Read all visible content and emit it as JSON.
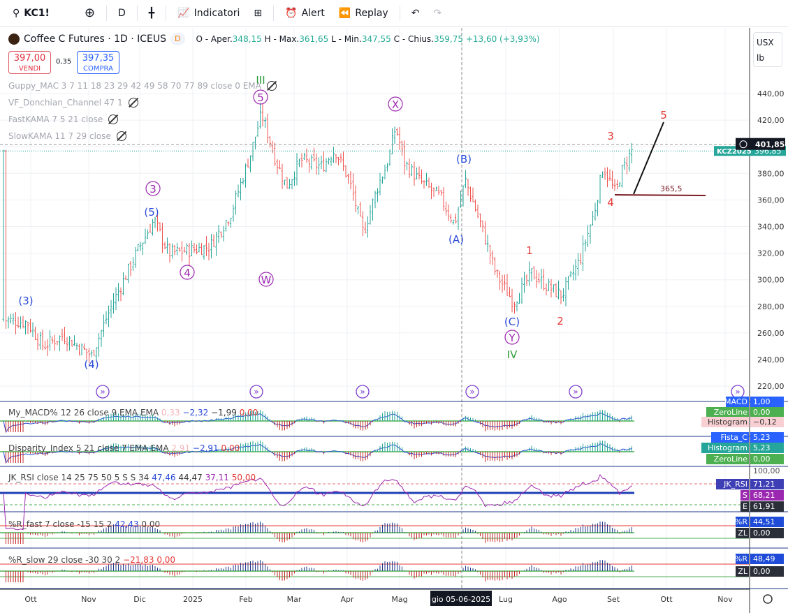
{
  "toolbar": {
    "symbol": "KC1!",
    "interval": "D",
    "indicators": "Indicatori",
    "alert": "Alert",
    "replay": "Replay"
  },
  "legend": {
    "title": "Coffee C Futures · 1D · ICEUS",
    "badge": "D",
    "o_label": "O - Aper.",
    "o": "348,15",
    "h_label": "H - Max.",
    "h": "361,65",
    "l_label": "L - Min.",
    "l": "347,55",
    "c_label": "C - Chius.",
    "c": "359,75",
    "change": "+13,60 (+3,93%)"
  },
  "trade": {
    "sell_price": "397,00",
    "sell_label": "VENDI",
    "spread": "0,35",
    "buy_price": "397,35",
    "buy_label": "COMPRA"
  },
  "indicators": [
    "Guppy_MAC 3 7 11 18 23 29 42 49 58 70 77 89 close 0 EMA",
    "VF_Donchian_Channel 47 1",
    "FastKAMA 7 5 21 close",
    "SlowKAMA 11 7 29 close"
  ],
  "price_axis": {
    "currency": "USX",
    "unit": "lb",
    "ticks": [
      "440,00",
      "420,00",
      "400,00",
      "380,00",
      "360,00",
      "340,00",
      "320,00",
      "300,00",
      "280,00",
      "260,00",
      "240,00",
      "220,00"
    ],
    "crosshair_price": "401,85",
    "symbol_label": "KCZ2025",
    "symbol_price": "396,85"
  },
  "time_axis": {
    "ticks": [
      "Ott",
      "Nov",
      "Dic",
      "2025",
      "Feb",
      "Mar",
      "Apr",
      "Mag",
      "Lug",
      "Ago",
      "Set",
      "Ott",
      "Nov"
    ],
    "crosshair_date": "gio 05-06-2025"
  },
  "waves": [
    {
      "t": "(3)",
      "c": "#2a4bd7"
    },
    {
      "t": "(4)",
      "c": "#2a4bd7"
    },
    {
      "t": "3",
      "c": "#9c27b0"
    },
    {
      "t": "(5)",
      "c": "#2a4bd7"
    },
    {
      "t": "4",
      "c": "#9c27b0"
    },
    {
      "t": "W",
      "c": "#9c27b0"
    },
    {
      "t": "III",
      "c": "#2e9b3a"
    },
    {
      "t": "5",
      "c": "#9c27b0"
    },
    {
      "t": "X",
      "c": "#9c27b0"
    },
    {
      "t": "(B)",
      "c": "#2a4bd7"
    },
    {
      "t": "(A)",
      "c": "#2a4bd7"
    },
    {
      "t": "(C)",
      "c": "#2a4bd7"
    },
    {
      "t": "Y",
      "c": "#9c27b0"
    },
    {
      "t": "IV",
      "c": "#2e9b3a"
    },
    {
      "t": "1",
      "c": "#e53935"
    },
    {
      "t": "2",
      "c": "#e53935"
    },
    {
      "t": "3",
      "c": "#e53935"
    },
    {
      "t": "4",
      "c": "#e53935"
    },
    {
      "t": "5",
      "c": "#e53935"
    }
  ],
  "level_label": "365,5",
  "panes": {
    "macd": {
      "legend": "My_MACD% 12 26 close 9 EMA EMA",
      "v1": "0,33",
      "v2": "−2,32",
      "v3": "−1,99",
      "v4": "0,00",
      "labels": [
        {
          "n": "MACD",
          "v": "1,00"
        },
        {
          "n": "ZeroLine",
          "v": "0,00"
        },
        {
          "n": "Histogram",
          "v": "−0,12"
        }
      ]
    },
    "disparity": {
      "legend": "Disparity_Index 5 21 close 7 EMA EMA",
      "v1": "2,91",
      "v2": "−2,91",
      "v3": "0,00",
      "labels": [
        {
          "n": "Fista_C",
          "v": "5,23"
        },
        {
          "n": "Histogram",
          "v": "5,23"
        },
        {
          "n": "ZeroLine",
          "v": "0,00"
        }
      ]
    },
    "rsi": {
      "legend": "JK_RSI close 14 25 75 50 5 S S 34",
      "v1": "47,46",
      "v2": "44,47",
      "v3": "37,11",
      "v4": "50,00",
      "top": "100,00",
      "labels": [
        {
          "n": "JK_RSI",
          "v": "71,21"
        },
        {
          "n": "S",
          "v": "68,21"
        },
        {
          "n": "E",
          "v": "61,91"
        }
      ]
    },
    "rfast": {
      "legend": "%R_fast 7 close -15 15 2",
      "v1": "42,43",
      "v2": "0,00",
      "labels": [
        {
          "n": "%R",
          "v": "44,51"
        },
        {
          "n": "ZL",
          "v": "0,00"
        }
      ]
    },
    "rslow": {
      "legend": "%R_slow 29 close -30 30 2",
      "v1": "−21,83",
      "v2": "0,00",
      "labels": [
        {
          "n": "%R",
          "v": "48,49"
        },
        {
          "n": "ZL",
          "v": "0,00"
        }
      ]
    }
  },
  "chart_data": {
    "type": "ohlc",
    "ylim": [
      210,
      450
    ],
    "x_unit": "days since 2024-10-01",
    "close_path": [
      [
        -15,
        270
      ],
      [
        -2,
        268
      ],
      [
        7,
        250
      ],
      [
        18,
        258
      ],
      [
        34,
        243
      ],
      [
        45,
        280
      ],
      [
        59,
        320
      ],
      [
        69,
        345
      ],
      [
        77,
        320
      ],
      [
        88,
        322
      ],
      [
        100,
        325
      ],
      [
        112,
        350
      ],
      [
        123,
        395
      ],
      [
        129,
        425
      ],
      [
        137,
        390
      ],
      [
        143,
        370
      ],
      [
        151,
        390
      ],
      [
        163,
        385
      ],
      [
        170,
        398
      ],
      [
        178,
        375
      ],
      [
        184,
        345
      ],
      [
        186,
        335
      ],
      [
        194,
        370
      ],
      [
        200,
        390
      ],
      [
        204,
        415
      ],
      [
        209,
        388
      ],
      [
        217,
        375
      ],
      [
        229,
        362
      ],
      [
        237,
        342
      ],
      [
        243,
        375
      ],
      [
        252,
        340
      ],
      [
        260,
        305
      ],
      [
        270,
        283
      ],
      [
        280,
        305
      ],
      [
        289,
        295
      ],
      [
        297,
        288
      ],
      [
        307,
        315
      ],
      [
        315,
        350
      ],
      [
        320,
        385
      ],
      [
        327,
        365
      ],
      [
        330,
        380
      ],
      [
        336,
        397
      ]
    ],
    "up_color": "#26a69a",
    "down_color": "#ef5350"
  }
}
